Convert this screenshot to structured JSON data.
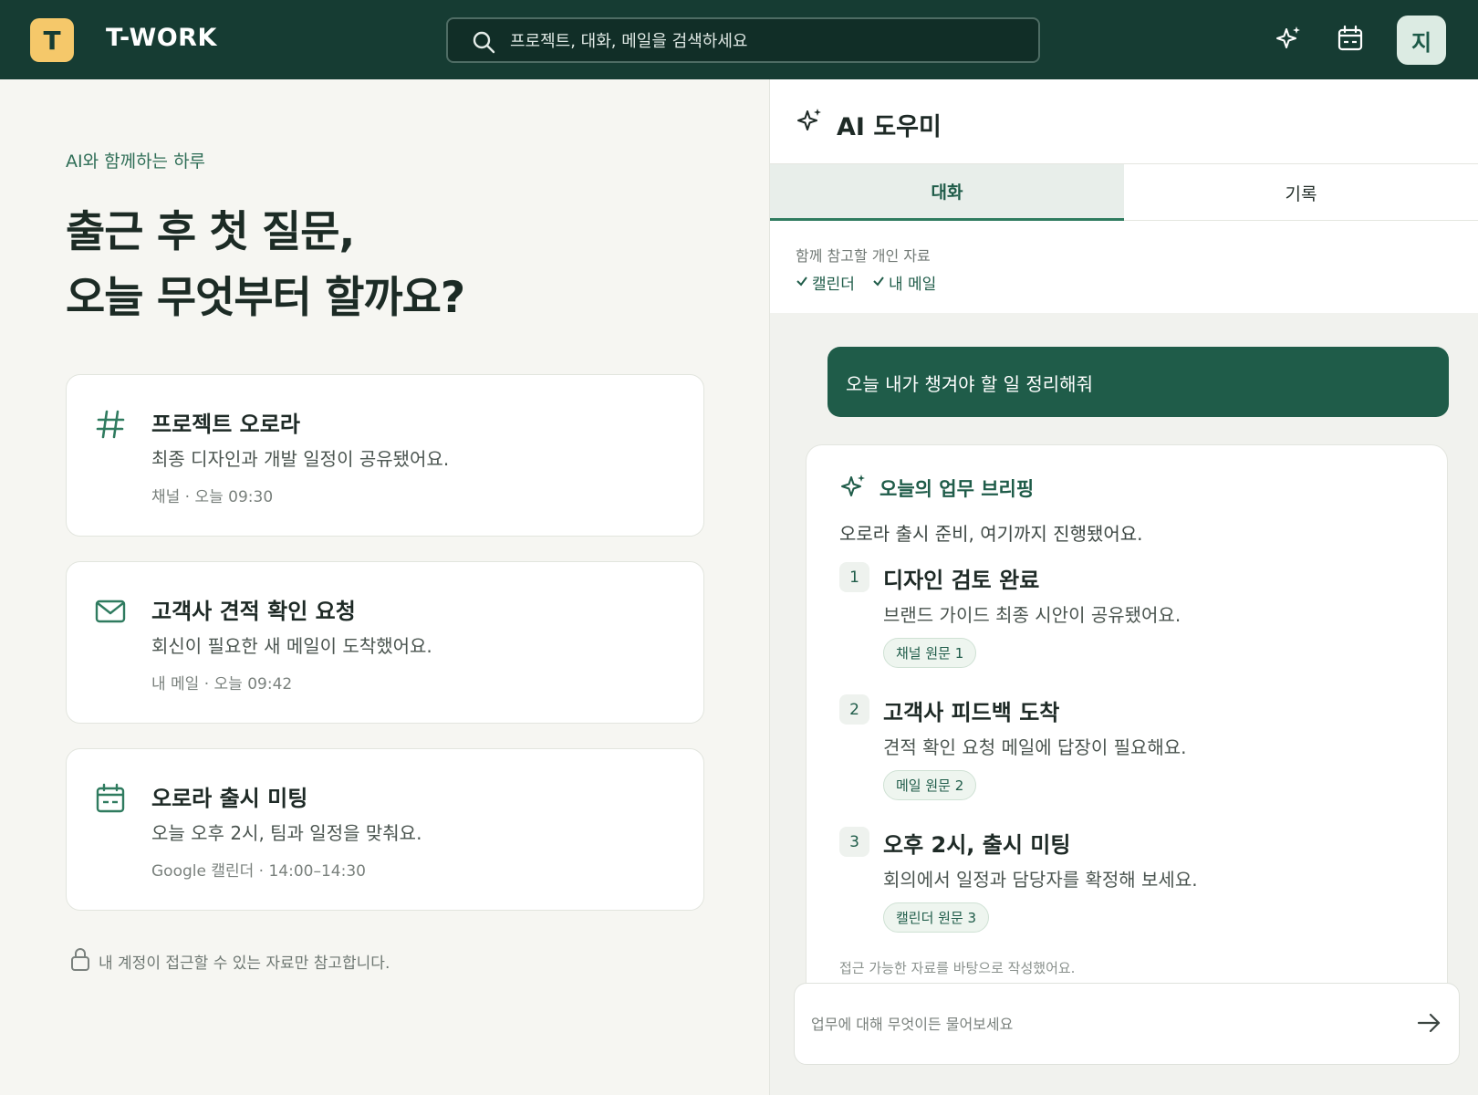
{
  "header": {
    "logo_letter": "T",
    "app_name": "T-WORK",
    "search_placeholder": "프로젝트, 대화, 메일을 검색하세요",
    "avatar_letter": "지"
  },
  "left": {
    "eyebrow": "AI와 함께하는 하루",
    "headline_line1": "출근 후 첫 질문,",
    "headline_line2": "오늘 무엇부터 할까요?",
    "cards": [
      {
        "icon": "hash-icon",
        "title": "프로젝트 오로라",
        "desc": "최종 디자인과 개발 일정이 공유됐어요.",
        "meta": "채널 · 오늘 09:30"
      },
      {
        "icon": "mail-icon",
        "title": "고객사 견적 확인 요청",
        "desc": "회신이 필요한 새 메일이 도착했어요.",
        "meta": "내 메일 · 오늘 09:42"
      },
      {
        "icon": "calendar-icon",
        "title": "오로라 출시 미팅",
        "desc": "오늘 오후 2시, 팀과 일정을 맞춰요.",
        "meta": "Google 캘린더 · 14:00–14:30"
      }
    ],
    "privacy_note": "내 계정이 접근할 수 있는 자료만 참고합니다."
  },
  "assistant": {
    "title": "AI 도우미",
    "tabs": [
      {
        "label": "대화"
      },
      {
        "label": "기록"
      }
    ],
    "context_label": "함께 참고할 개인 자료",
    "context_items": [
      {
        "label": "캘린더"
      },
      {
        "label": "내 메일"
      }
    ],
    "user_message": "오늘 내가 챙겨야 할 일 정리해줘",
    "briefing": {
      "title": "오늘의 업무 브리핑",
      "summary": "오로라 출시 준비, 여기까지 진행됐어요.",
      "items": [
        {
          "num": "1",
          "title": "디자인 검토 완료",
          "desc": "브랜드 가이드 최종 시안이 공유됐어요.",
          "source": "채널 원문 1"
        },
        {
          "num": "2",
          "title": "고객사 피드백 도착",
          "desc": "견적 확인 요청 메일에 답장이 필요해요.",
          "source": "메일 원문 2"
        },
        {
          "num": "3",
          "title": "오후 2시, 출시 미팅",
          "desc": "회의에서 일정과 담당자를 확정해 보세요.",
          "source": "캘린더 원문 3"
        }
      ],
      "footnote": "접근 가능한 자료를 바탕으로 작성했어요."
    },
    "composer_placeholder": "업무에 대해 무엇이든 물어보세요"
  },
  "colors": {
    "header_bg": "#163c33",
    "accent": "#1f5c49",
    "logo_bg": "#f5c86a"
  }
}
